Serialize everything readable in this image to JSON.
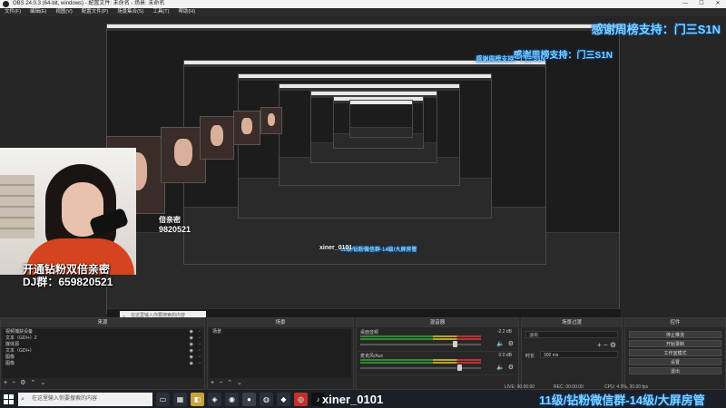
{
  "window": {
    "title": "OBS 24.0.3 (64-bit, windows) - 配置文件: 未命名 - 场景: 未命名",
    "controls": [
      "—",
      "☐",
      "✕"
    ]
  },
  "menu": [
    "文件(F)",
    "编辑(E)",
    "视图(V)",
    "配置文件(P)",
    "场景集合(S)",
    "工具(T)",
    "帮助(H)"
  ],
  "overlay": {
    "thanks_banner": "感谢周榜支持：门三S1N",
    "promo_line1": "开通钻粉双倍亲密",
    "promo_line2": "DJ群：659820521",
    "nested_promo": "倍亲密",
    "nested_number": "9820521",
    "douyin_id": "xiner_0101",
    "bottom_banner": "11级/钻粉微信群-14级/大屏房管"
  },
  "docks": {
    "sources": {
      "title": "来源",
      "items": [
        "视频捕获设备",
        "文本（GDI+）2",
        "媒体源",
        "文本（GDI+）",
        "图像",
        "图像"
      ]
    },
    "scenes": {
      "title": "场景",
      "items": [
        "场景"
      ]
    },
    "mixer": {
      "title": "混音器",
      "channels": [
        {
          "name": "桌面音频",
          "db": "-2.2 dB",
          "level": 0.78
        },
        {
          "name": "麦克风/Aux",
          "db": "0.0 dB",
          "level": 0.82
        }
      ]
    },
    "transitions": {
      "title": "场景过渡",
      "type": "淡出",
      "duration_label": "时长",
      "duration": "300 ms"
    },
    "controls": {
      "title": "控件",
      "buttons": [
        "停止推流",
        "开始录制",
        "工作室模式",
        "设置",
        "退出"
      ]
    }
  },
  "status": {
    "live": "LIVE: 00:00:00",
    "rec": "REC: 00:00:00",
    "cpu": "CPU: 4.9%, 30.00 fps"
  },
  "taskbar": {
    "search_placeholder": "在这里输入你要搜索的内容"
  },
  "colors": {
    "banner_text": "#7fd2ff",
    "banner_glow": "#0a4fa0",
    "obs_bg": "#2b2b2b"
  }
}
